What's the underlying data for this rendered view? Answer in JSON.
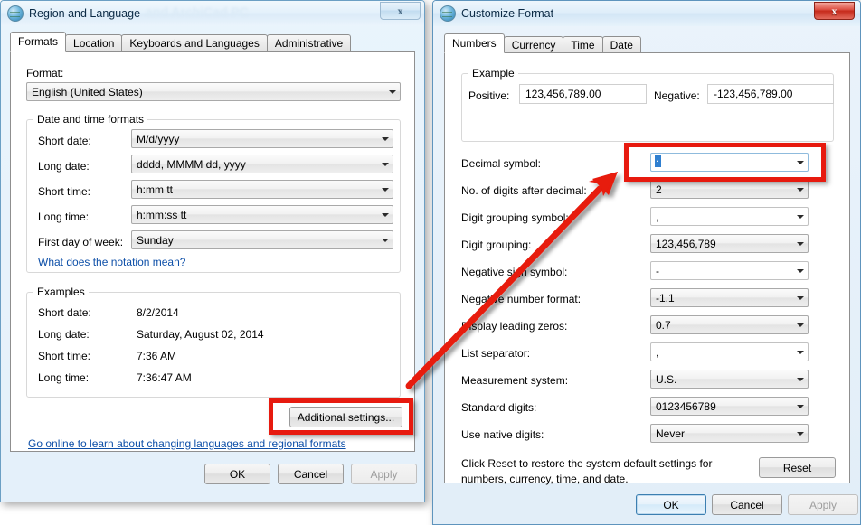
{
  "region_dialog": {
    "title": "Region and Language",
    "ghost_title": "and ArchiCad PC",
    "close_label": "x",
    "tabs": [
      {
        "label": "Formats",
        "selected": true
      },
      {
        "label": "Location",
        "selected": false
      },
      {
        "label": "Keyboards and Languages",
        "selected": false
      },
      {
        "label": "Administrative",
        "selected": false
      }
    ],
    "format_label": "Format:",
    "format_value": "English (United States)",
    "datetime_group": {
      "legend": "Date and time formats",
      "rows": [
        {
          "label": "Short date:",
          "value": "M/d/yyyy"
        },
        {
          "label": "Long date:",
          "value": "dddd, MMMM dd, yyyy"
        },
        {
          "label": "Short time:",
          "value": "h:mm tt"
        },
        {
          "label": "Long time:",
          "value": "h:mm:ss tt"
        },
        {
          "label": "First day of week:",
          "value": "Sunday"
        }
      ],
      "notation_link": "What does the notation mean?"
    },
    "examples_group": {
      "legend": "Examples",
      "rows": [
        {
          "label": "Short date:",
          "value": "8/2/2014"
        },
        {
          "label": "Long date:",
          "value": "Saturday, August 02, 2014"
        },
        {
          "label": "Short time:",
          "value": "7:36 AM"
        },
        {
          "label": "Long time:",
          "value": "7:36:47 AM"
        }
      ]
    },
    "additional_settings_button": "Additional settings...",
    "go_online_link": "Go online to learn about changing languages and regional formats",
    "buttons": {
      "ok": "OK",
      "cancel": "Cancel",
      "apply": "Apply"
    }
  },
  "customize_dialog": {
    "title": "Customize Format",
    "close_label": "x",
    "tabs": [
      {
        "label": "Numbers",
        "selected": true
      },
      {
        "label": "Currency",
        "selected": false
      },
      {
        "label": "Time",
        "selected": false
      },
      {
        "label": "Date",
        "selected": false
      }
    ],
    "example_group": {
      "legend": "Example",
      "positive_label": "Positive:",
      "positive_value": "123,456,789.00",
      "negative_label": "Negative:",
      "negative_value": "-123,456,789.00"
    },
    "fields": [
      {
        "label": "Decimal symbol:",
        "value": ".",
        "style": "edit-selected"
      },
      {
        "label": "No. of digits after decimal:",
        "value": "2",
        "style": "dropdown"
      },
      {
        "label": "Digit grouping symbol:",
        "value": ",",
        "style": "edit"
      },
      {
        "label": "Digit grouping:",
        "value": "123,456,789",
        "style": "dropdown"
      },
      {
        "label": "Negative sign symbol:",
        "value": "-",
        "style": "edit"
      },
      {
        "label": "Negative number format:",
        "value": "-1.1",
        "style": "dropdown"
      },
      {
        "label": "Display leading zeros:",
        "value": "0.7",
        "style": "dropdown"
      },
      {
        "label": "List separator:",
        "value": ",",
        "style": "edit"
      },
      {
        "label": "Measurement system:",
        "value": "U.S.",
        "style": "dropdown"
      },
      {
        "label": "Standard digits:",
        "value": "0123456789",
        "style": "dropdown"
      },
      {
        "label": "Use native digits:",
        "value": "Never",
        "style": "dropdown"
      }
    ],
    "reset_text_line1": "Click Reset to restore the system default settings for",
    "reset_text_line2": "numbers, currency, time, and date.",
    "reset_button": "Reset",
    "buttons": {
      "ok": "OK",
      "cancel": "Cancel",
      "apply": "Apply"
    }
  },
  "annotations": {
    "highlight_color": "#e71a0f",
    "arrow_from": "Additional settings... button",
    "arrow_to": "Decimal symbol field"
  }
}
